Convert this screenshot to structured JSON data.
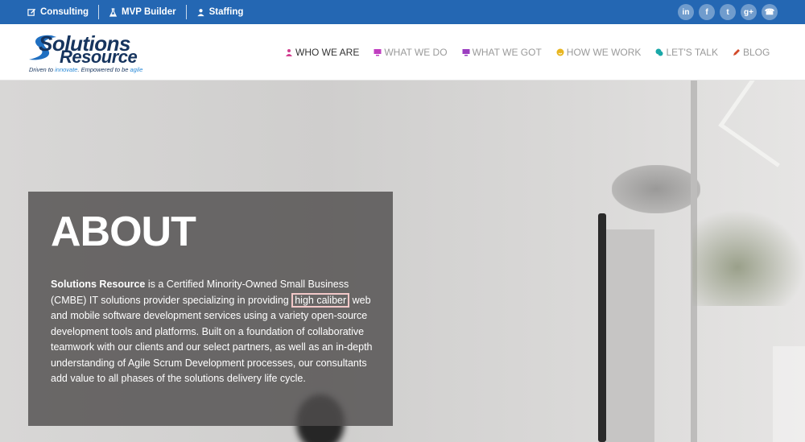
{
  "topbar": {
    "links": [
      {
        "label": "Consulting",
        "icon": "edit-icon"
      },
      {
        "label": "MVP Builder",
        "icon": "flask-icon"
      },
      {
        "label": "Staffing",
        "icon": "person-icon"
      }
    ],
    "socials": [
      {
        "icon": "linkedin-icon",
        "glyph": "in"
      },
      {
        "icon": "facebook-icon",
        "glyph": "f"
      },
      {
        "icon": "twitter-icon",
        "glyph": "t"
      },
      {
        "icon": "google-plus-icon",
        "glyph": "g+"
      },
      {
        "icon": "phone-icon",
        "glyph": "☎"
      }
    ]
  },
  "logo": {
    "word1": "Solutions",
    "word2": "Resource",
    "tag_prefix": "Driven to ",
    "tag_innovate": "innovate",
    "tag_mid": ". Empowered to be ",
    "tag_agile": "agile"
  },
  "nav": {
    "items": [
      {
        "label": "WHO WE ARE",
        "icon": "person-icon",
        "color": "#d13d8f",
        "active": true
      },
      {
        "label": "WHAT WE DO",
        "icon": "monitor-icon",
        "color": "#c03ec0"
      },
      {
        "label": "WHAT WE GOT",
        "icon": "monitor-icon",
        "color": "#9b3ec0"
      },
      {
        "label": "HOW WE WORK",
        "icon": "smile-icon",
        "color": "#e8b620"
      },
      {
        "label": "LET'S TALK",
        "icon": "chat-icon",
        "color": "#1aa8a8"
      },
      {
        "label": "BLOG",
        "icon": "pencil-icon",
        "color": "#d24a2a"
      }
    ]
  },
  "about": {
    "title": "ABOUT",
    "company": "Solutions Resource",
    "text_part1": " is a Certified Minority-Owned Small Business (CMBE) IT solutions provider specializing in providing",
    "highlight": "high caliber",
    "text_part2": "web and mobile software development services using a variety open-source development tools and platforms. Built on a foundation of collaborative teamwork with our clients and our select partners, as well as an in-depth understanding of Agile Scrum Development processes, our consultants add value to all phases of the solutions delivery life cycle."
  },
  "colors": {
    "topbar": "#2467b3",
    "logo_navy": "#16345e",
    "logo_blue": "#2a8ad8",
    "highlight_border": "#f2c8c8"
  }
}
